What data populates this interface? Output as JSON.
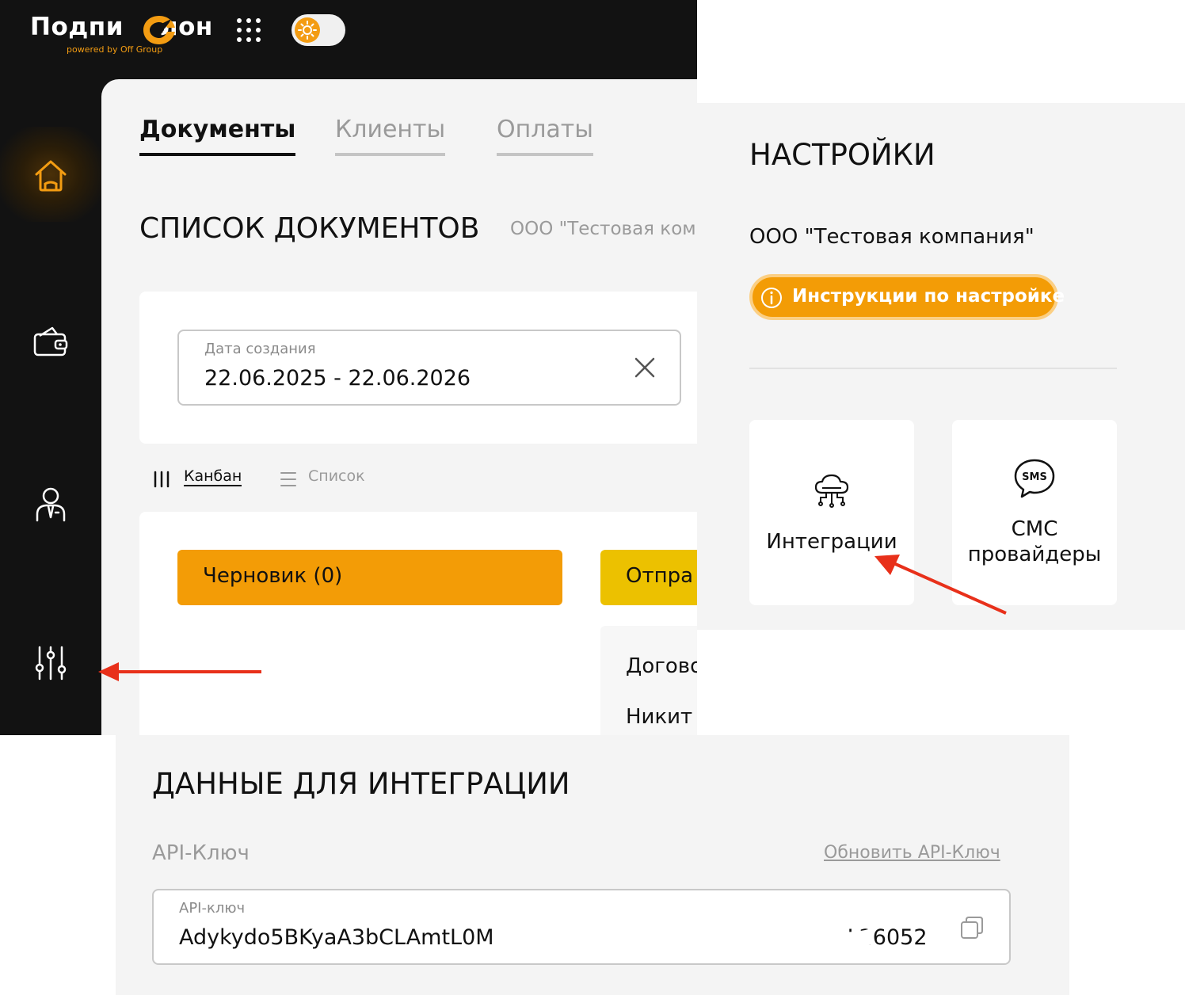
{
  "app": {
    "logo": {
      "text_before": "Подпи",
      "text_after": "лон",
      "tagline": "powered by Off Group"
    },
    "sidebar": {
      "items": [
        {
          "name": "home",
          "icon": "home-icon",
          "active": true
        },
        {
          "name": "wallet",
          "icon": "wallet-icon",
          "active": false
        },
        {
          "name": "clients",
          "icon": "user-icon",
          "active": false
        },
        {
          "name": "settings",
          "icon": "sliders-icon",
          "active": false
        }
      ]
    },
    "tabs": [
      {
        "label": "Документы",
        "active": true
      },
      {
        "label": "Клиенты",
        "active": false
      },
      {
        "label": "Оплаты",
        "active": false
      }
    ],
    "page_title": "СПИСОК ДОКУМЕНТОВ",
    "company": "ООО \"Тестовая комг",
    "filter": {
      "label": "Дата создания",
      "value": "22.06.2025 - 22.06.2026"
    },
    "views": {
      "kanban": "Канбан",
      "list": "Список",
      "active": "kanban"
    },
    "columns": [
      {
        "label": "Черновик (0)",
        "color": "#f39c06"
      },
      {
        "label": "Отпра",
        "color": "#ecc100"
      }
    ],
    "card": {
      "title": "Догово",
      "client": "Никит"
    }
  },
  "settings": {
    "title": "НАСТРОЙКИ",
    "company": "ООО \"Тестовая компания\"",
    "instructions_button": "Инструкции по настройке",
    "cards": [
      {
        "label": "Интеграции",
        "icon": "cloud-network-icon"
      },
      {
        "label": "СМС провайдеры",
        "icon": "sms-bubble-icon"
      }
    ]
  },
  "integration": {
    "title": "ДАННЫЕ ДЛЯ ИНТЕГРАЦИИ",
    "section_label": "API-Ключ",
    "refresh_link": "Обновить API-Ключ",
    "field_label": "API-ключ",
    "field_value_start": "Adykydo5BKyaA3bCLAmtL0M",
    "field_value_end": "L26052"
  },
  "colors": {
    "accent": "#f39c06",
    "dark_bg": "#121212",
    "panel_bg": "#f4f4f4",
    "annotation_arrow": "#e8301a"
  }
}
